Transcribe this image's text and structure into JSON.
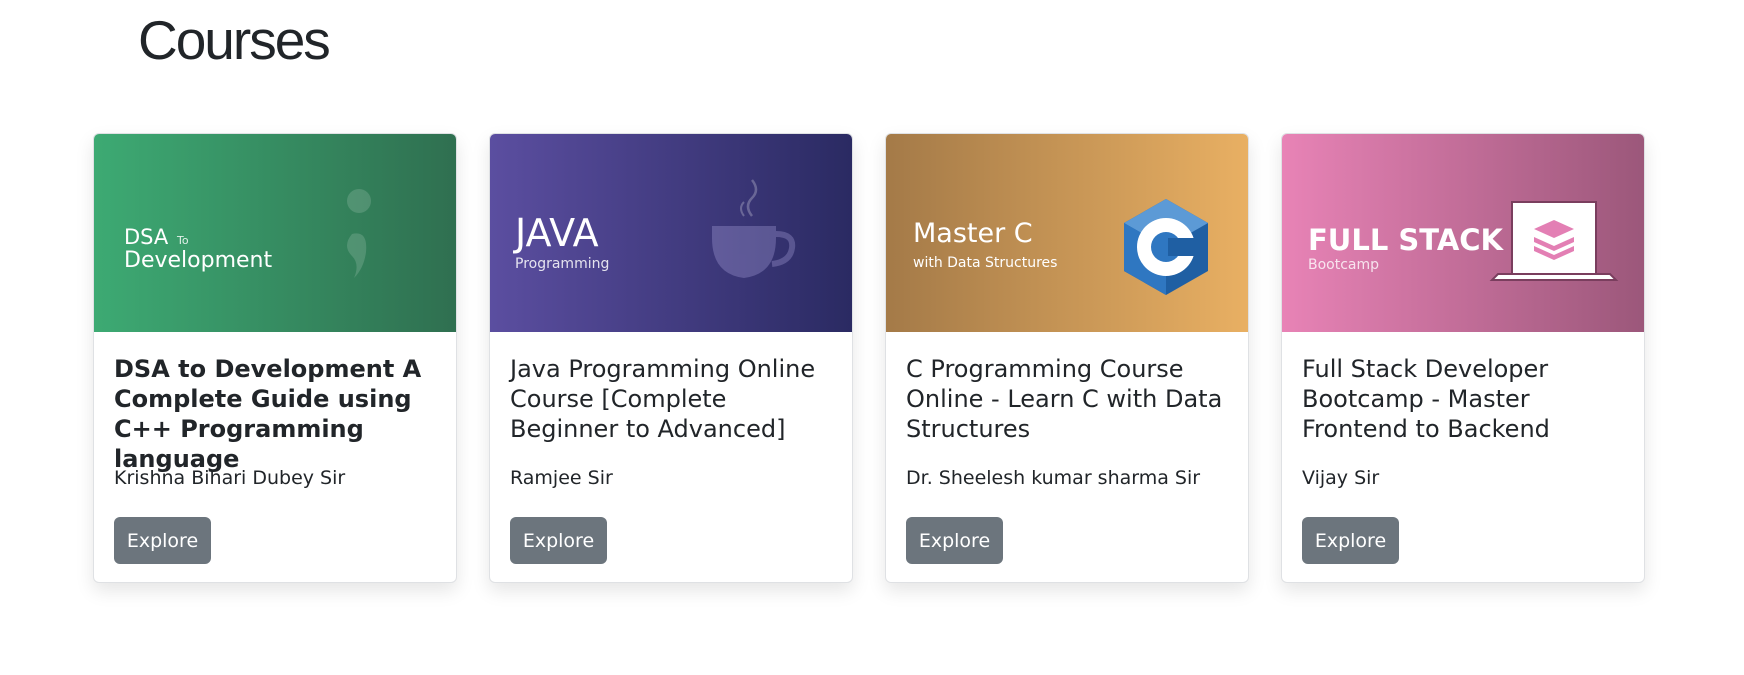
{
  "page": {
    "title": "Courses"
  },
  "courses": [
    {
      "banner_line1": "DSA",
      "banner_small": "To",
      "banner_line2": "Development",
      "title": "DSA to Development A Complete Guide using C++ Programming language",
      "instructor": "Krishna Bihari Dubey Sir",
      "button": "Explore",
      "colors": {
        "from": "#3daa73",
        "to": "#2f6f50"
      },
      "icon": "semicolon-icon"
    },
    {
      "banner_line1": "JAVA",
      "banner_sub": "Programming",
      "title": "Java Programming Online Course [Complete Beginner to Advanced]",
      "instructor": "Ramjee Sir",
      "button": "Explore",
      "colors": {
        "from": "#5b4ea0",
        "to": "#2a2a62"
      },
      "icon": "coffee-cup-icon"
    },
    {
      "banner_line1": "Master C",
      "banner_sub": "with Data Structures",
      "title": "C Programming Course Online - Learn C with Data Structures",
      "instructor": "Dr. Sheelesh kumar sharma Sir",
      "button": "Explore",
      "colors": {
        "from": "#a47a48",
        "to": "#e9b063"
      },
      "icon": "c-language-icon"
    },
    {
      "banner_line1": "FULL STACK",
      "banner_sub": "Bootcamp",
      "title": "Full Stack Developer Bootcamp - Master Frontend to Backend",
      "instructor": "Vijay Sir",
      "button": "Explore",
      "colors": {
        "from": "#e883b6",
        "to": "#9b577a"
      },
      "icon": "laptop-layers-icon"
    }
  ]
}
